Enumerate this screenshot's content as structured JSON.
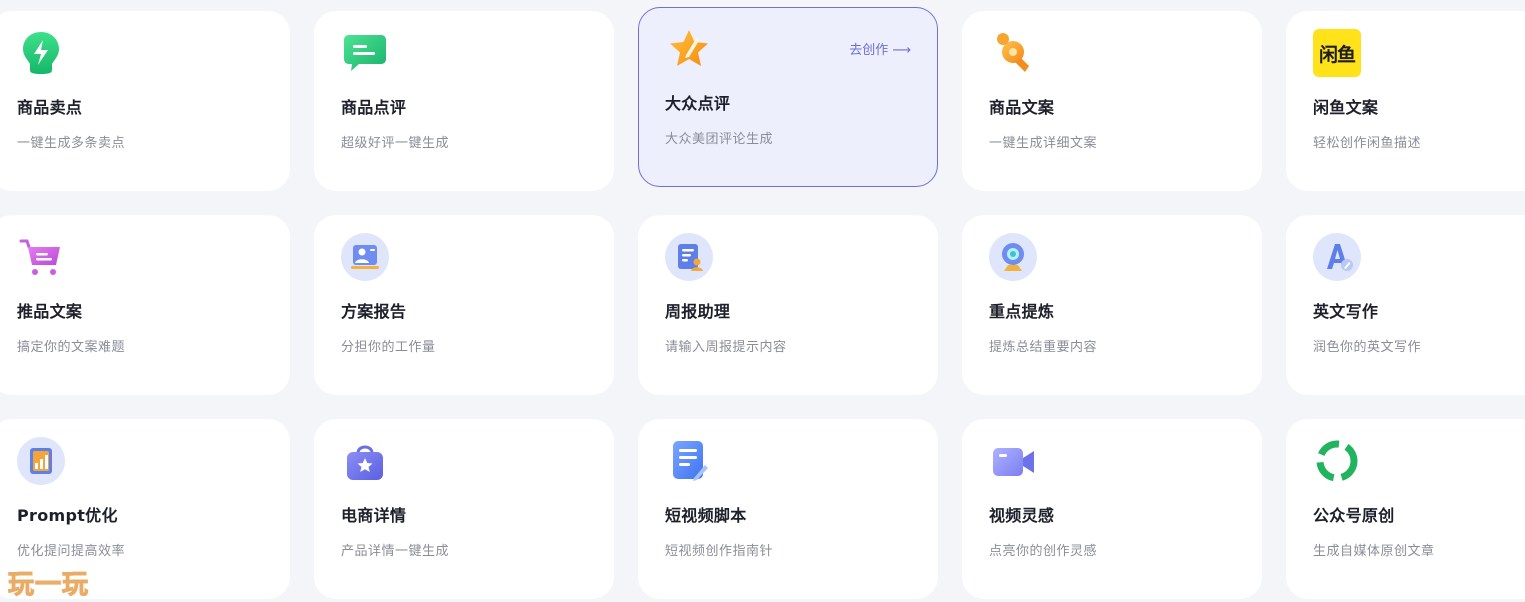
{
  "cards": [
    {
      "title": "商品卖点",
      "desc": "一键生成多条卖点",
      "icon": "lightning-bulb-icon"
    },
    {
      "title": "商品点评",
      "desc": "超级好评一键生成",
      "icon": "chat-bubble-icon"
    },
    {
      "title": "大众点评",
      "desc": "大众美团评论生成",
      "icon": "star-pen-icon",
      "action_label": "去创作 ⟶",
      "active": true
    },
    {
      "title": "商品文案",
      "desc": "一键生成详细文案",
      "icon": "rocket-icon"
    },
    {
      "title": "闲鱼文案",
      "desc": "轻松创作闲鱼描述",
      "icon": "xianyu-logo-icon",
      "logo_text": "闲鱼"
    },
    {
      "title": "推品文案",
      "desc": "搞定你的文案难题",
      "icon": "shopping-cart-icon"
    },
    {
      "title": "方案报告",
      "desc": "分担你的工作量",
      "icon": "presentation-report-icon"
    },
    {
      "title": "周报助理",
      "desc": "请输入周报提示内容",
      "icon": "weekly-report-icon"
    },
    {
      "title": "重点提炼",
      "desc": "提炼总结重要内容",
      "icon": "webcam-icon"
    },
    {
      "title": "英文写作",
      "desc": "润色你的英文写作",
      "icon": "letter-a-pen-icon"
    },
    {
      "title": "Prompt优化",
      "desc": "优化提问提高效率",
      "icon": "chart-clipboard-icon"
    },
    {
      "title": "电商详情",
      "desc": "产品详情一键生成",
      "icon": "shopping-bag-star-icon"
    },
    {
      "title": "短视频脚本",
      "desc": "短视频创作指南针",
      "icon": "document-edit-icon"
    },
    {
      "title": "视频灵感",
      "desc": "点亮你的创作灵感",
      "icon": "video-camera-icon"
    },
    {
      "title": "公众号原创",
      "desc": "生成自媒体原创文章",
      "icon": "wechat-official-account-icon"
    }
  ],
  "watermark": "玩一玩",
  "colors": {
    "accent": "#6c6fcf",
    "active_card_bg": "#eeeffd",
    "page_bg": "#f4f5f9"
  }
}
